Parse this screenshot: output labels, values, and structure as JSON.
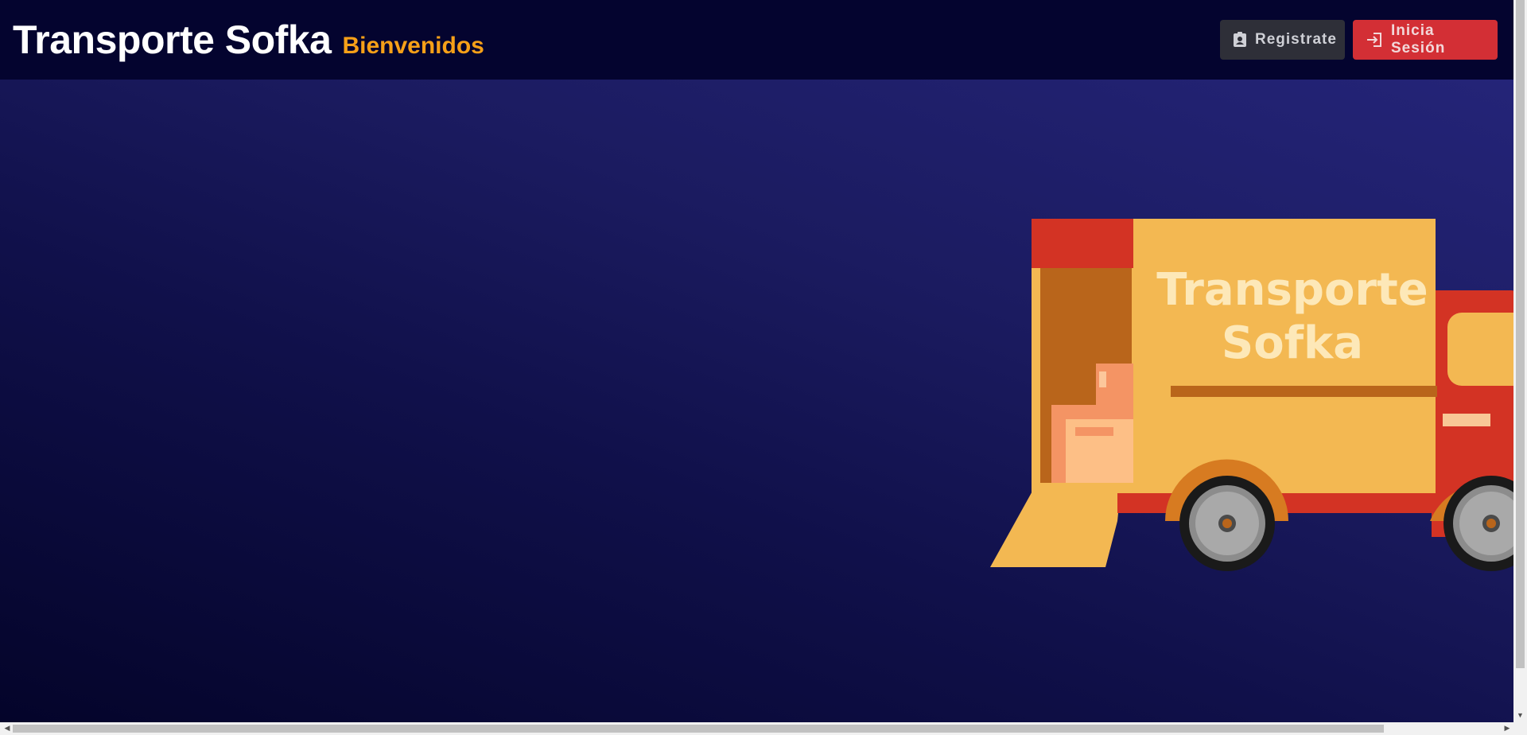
{
  "header": {
    "title": "Transporte Sofka",
    "subtitle": "Bienvenidos",
    "register_button": {
      "label": "Registrate",
      "icon": "id-badge-icon"
    },
    "login_button": {
      "label": "Inicia Sesión",
      "icon": "login-icon"
    }
  },
  "hero": {
    "illustration": "truck-illustration",
    "truck_text_line1": "Transporte",
    "truck_text_line2": "Sofka"
  },
  "colors": {
    "navbar_bg": "#04042f",
    "subtitle": "#f6a018",
    "register_bg": "#2e2f38",
    "login_bg": "#d32f35",
    "truck_cargo": "#f3b852",
    "truck_cab": "#d33324"
  }
}
